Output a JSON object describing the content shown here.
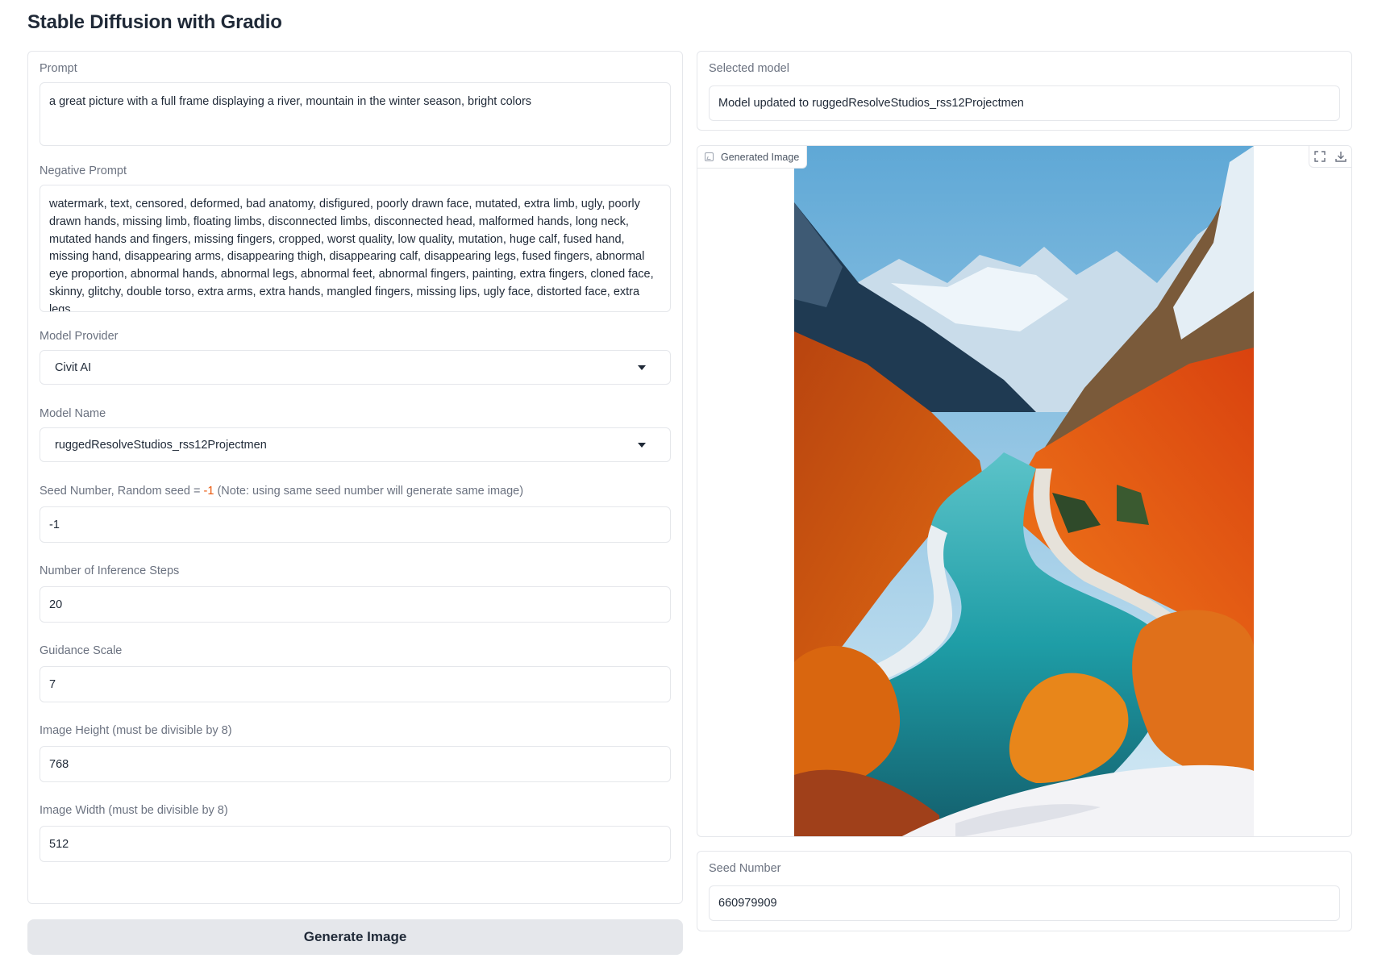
{
  "app": {
    "title": "Stable Diffusion with Gradio"
  },
  "left": {
    "prompt": {
      "label": "Prompt",
      "value": "a great picture with a full frame displaying a river, mountain in the winter season, bright colors"
    },
    "negative_prompt": {
      "label": "Negative Prompt",
      "value": "watermark, text, censored, deformed, bad anatomy, disfigured, poorly drawn face, mutated, extra limb, ugly, poorly drawn hands, missing limb, floating limbs, disconnected limbs, disconnected head, malformed hands, long neck, mutated hands and fingers, missing fingers, cropped, worst quality, low quality, mutation, huge calf, fused hand, missing hand, disappearing arms, disappearing thigh, disappearing calf, disappearing legs, fused fingers, abnormal eye proportion, abnormal hands, abnormal legs, abnormal feet, abnormal fingers, painting, extra fingers, cloned face, skinny, glitchy, double torso, extra arms, extra hands, mangled fingers, missing lips, ugly face, distorted face, extra legs"
    },
    "model_provider": {
      "label": "Model Provider",
      "value": "Civit AI"
    },
    "model_name": {
      "label": "Model Name",
      "value": "ruggedResolveStudios_rss12Projectmen"
    },
    "seed": {
      "label_prefix": "Seed Number, Random seed = ",
      "label_accent": "-1",
      "label_suffix": " (Note: using same seed number will generate same image)",
      "value": "-1"
    },
    "steps": {
      "label": "Number of Inference Steps",
      "value": "20"
    },
    "guidance": {
      "label": "Guidance Scale",
      "value": "7"
    },
    "height": {
      "label": "Image Height (must be divisible by 8)",
      "value": "768"
    },
    "width": {
      "label": "Image Width (must be divisible by 8)",
      "value": "512"
    },
    "generate_button": "Generate Image"
  },
  "right": {
    "selected_model": {
      "label": "Selected model",
      "value": "Model updated to ruggedResolveStudios_rss12Projectmen"
    },
    "image": {
      "label": "Generated Image"
    },
    "seed_number": {
      "label": "Seed Number",
      "value": "660979909"
    }
  },
  "icons": [
    "image-icon",
    "fullscreen-icon",
    "download-icon",
    "chevron-down-icon"
  ],
  "colors": {
    "accent": "#ea580c",
    "button_bg": "#e5e7eb",
    "border": "#e5e7eb",
    "label": "#6b7280"
  }
}
